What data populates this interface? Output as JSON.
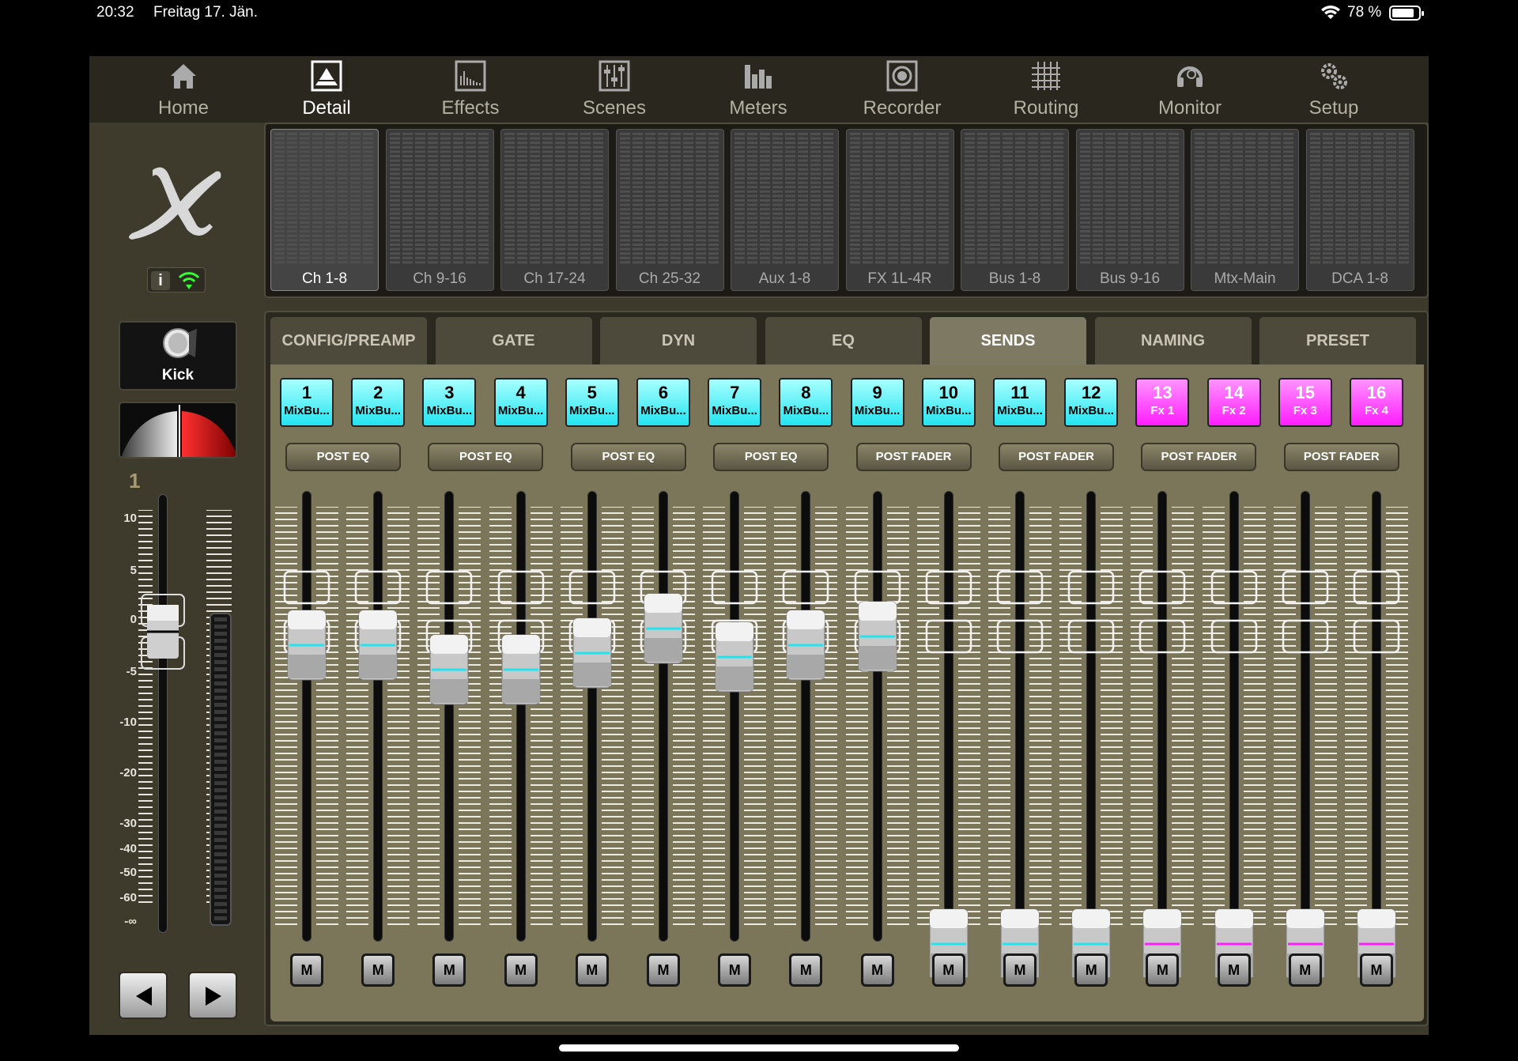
{
  "status": {
    "time": "20:32",
    "date": "Freitag 17. Jän.",
    "battery": "78 %"
  },
  "nav": [
    {
      "label": "Home",
      "icon": "house-icon"
    },
    {
      "label": "Detail",
      "icon": "detail-waveform-icon",
      "active": true
    },
    {
      "label": "Effects",
      "icon": "effects-icon"
    },
    {
      "label": "Scenes",
      "icon": "scenes-sliders-icon"
    },
    {
      "label": "Meters",
      "icon": "meters-bars-icon"
    },
    {
      "label": "Recorder",
      "icon": "recorder-icon"
    },
    {
      "label": "Routing",
      "icon": "routing-grid-icon"
    },
    {
      "label": "Monitor",
      "icon": "monitor-headphones-icon"
    },
    {
      "label": "Setup",
      "icon": "setup-gears-icon"
    }
  ],
  "left": {
    "info_label": "i",
    "channel_name": "Kick",
    "channel_number": "1",
    "scale": [
      "10",
      "5",
      "0",
      "-5",
      "-10",
      "-20",
      "-30",
      "-40",
      "-50",
      "-60",
      "-∞"
    ]
  },
  "banks": [
    {
      "label": "Ch 1-8",
      "active": true
    },
    {
      "label": "Ch 9-16"
    },
    {
      "label": "Ch 17-24"
    },
    {
      "label": "Ch 25-32"
    },
    {
      "label": "Aux 1-8"
    },
    {
      "label": "FX 1L-4R"
    },
    {
      "label": "Bus 1-8"
    },
    {
      "label": "Bus 9-16"
    },
    {
      "label": "Mtx-Main"
    },
    {
      "label": "DCA 1-8"
    }
  ],
  "tabs": [
    {
      "label": "CONFIG/PREAMP"
    },
    {
      "label": "GATE"
    },
    {
      "label": "DYN"
    },
    {
      "label": "EQ"
    },
    {
      "label": "SENDS",
      "active": true
    },
    {
      "label": "NAMING"
    },
    {
      "label": "PRESET"
    }
  ],
  "sends": [
    {
      "num": "1",
      "name": "MixBu...",
      "color": "#22e4f0",
      "level": 0.66
    },
    {
      "num": "2",
      "name": "MixBu...",
      "color": "#22e4f0",
      "level": 0.66
    },
    {
      "num": "3",
      "name": "MixBu...",
      "color": "#22e4f0",
      "level": 0.6
    },
    {
      "num": "4",
      "name": "MixBu...",
      "color": "#22e4f0",
      "level": 0.6
    },
    {
      "num": "5",
      "name": "MixBu...",
      "color": "#22e4f0",
      "level": 0.64
    },
    {
      "num": "6",
      "name": "MixBu...",
      "color": "#22e4f0",
      "level": 0.7
    },
    {
      "num": "7",
      "name": "MixBu...",
      "color": "#22e4f0",
      "level": 0.63
    },
    {
      "num": "8",
      "name": "MixBu...",
      "color": "#22e4f0",
      "level": 0.66
    },
    {
      "num": "9",
      "name": "MixBu...",
      "color": "#22e4f0",
      "level": 0.68
    },
    {
      "num": "10",
      "name": "MixBu...",
      "color": "#22e4f0",
      "level": 0
    },
    {
      "num": "11",
      "name": "MixBu...",
      "color": "#22e4f0",
      "level": 0
    },
    {
      "num": "12",
      "name": "MixBu...",
      "color": "#22e4f0",
      "level": 0
    },
    {
      "num": "13",
      "name": "Fx 1",
      "color": "#ff1dff",
      "level": 0
    },
    {
      "num": "14",
      "name": "Fx 2",
      "color": "#ff1dff",
      "level": 0
    },
    {
      "num": "15",
      "name": "Fx 3",
      "color": "#ff1dff",
      "level": 0
    },
    {
      "num": "16",
      "name": "Fx 4",
      "color": "#ff1dff",
      "level": 0
    }
  ],
  "taps": [
    "POST EQ",
    "POST EQ",
    "POST EQ",
    "POST EQ",
    "POST FADER",
    "POST FADER",
    "POST FADER",
    "POST FADER"
  ],
  "mute_label": "M"
}
